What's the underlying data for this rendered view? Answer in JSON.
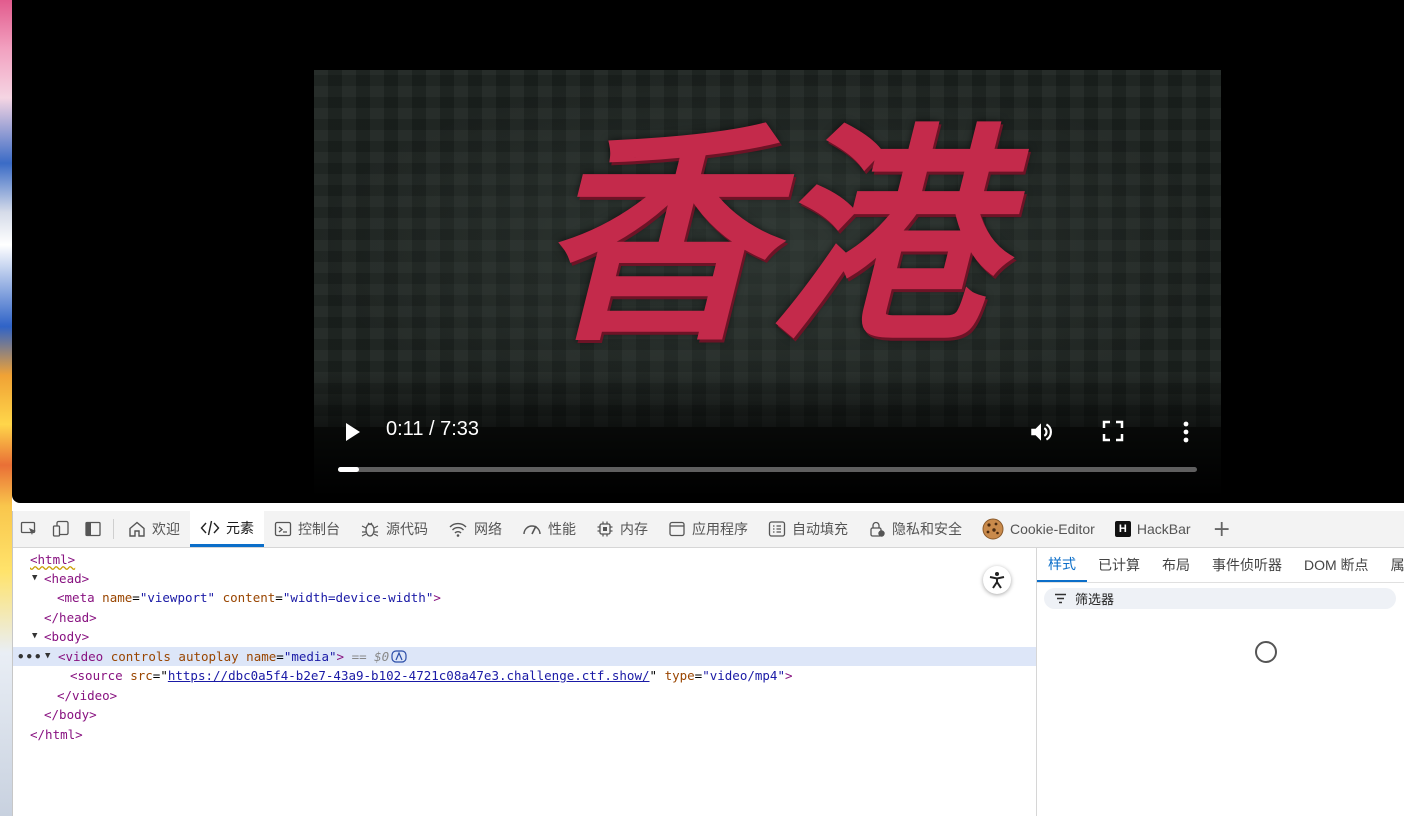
{
  "video": {
    "title_text": "香港",
    "time_display": "0:11 / 7:33",
    "progress_fraction": 0.024,
    "controls": [
      "play-icon",
      "volume-icon",
      "fullscreen-icon",
      "more-options-icon"
    ]
  },
  "devtools": {
    "tabs": [
      {
        "label": "欢迎",
        "icon": "home-icon"
      },
      {
        "label": "元素",
        "icon": "code-icon",
        "active": true
      },
      {
        "label": "控制台",
        "icon": "console-icon"
      },
      {
        "label": "源代码",
        "icon": "bug-icon"
      },
      {
        "label": "网络",
        "icon": "wifi-icon"
      },
      {
        "label": "性能",
        "icon": "gauge-icon"
      },
      {
        "label": "内存",
        "icon": "chip-icon"
      },
      {
        "label": "应用程序",
        "icon": "window-icon"
      },
      {
        "label": "自动填充",
        "icon": "list-icon"
      },
      {
        "label": "隐私和安全",
        "icon": "lock-icon"
      },
      {
        "label": "Cookie-Editor",
        "icon": "cookie-icon"
      },
      {
        "label": "HackBar",
        "icon": "hackbar-icon"
      }
    ],
    "hackbar_logo": "H",
    "add_tab": "+",
    "dom": {
      "html_open": "<html>",
      "head_open": "<head>",
      "meta_tag": "meta",
      "meta_attr1_name": "name",
      "meta_attr1_value": "\"viewport\"",
      "meta_attr2_name": "content",
      "meta_attr2_value": "\"width=device-width\"",
      "head_close": "</head>",
      "body_open": "<body>",
      "video_tag": "video",
      "video_attrs": "controls autoplay",
      "video_name_attr": "name",
      "video_name_value": "\"media\"",
      "selected_marker": "== $0",
      "source_tag": "source",
      "source_src_attr": "src",
      "source_src_value": "https://dbc0a5f4-b2e7-43a9-b102-4721c08a47e3.challenge.ctf.show/",
      "source_type_attr": "type",
      "source_type_value": "\"video/mp4\"",
      "video_close": "</video>",
      "body_close": "</body>",
      "html_close": "</html>",
      "ellipsis": "•••"
    },
    "side_tabs": [
      {
        "label": "样式",
        "active": true
      },
      {
        "label": "已计算"
      },
      {
        "label": "布局"
      },
      {
        "label": "事件侦听器"
      },
      {
        "label": "DOM 断点"
      },
      {
        "label": "属性"
      }
    ],
    "filter_placeholder": "筛选器"
  },
  "colors": {
    "accent": "#0b6ec9",
    "title_red": "#c42a4b",
    "selected_row": "#dde6f8"
  }
}
